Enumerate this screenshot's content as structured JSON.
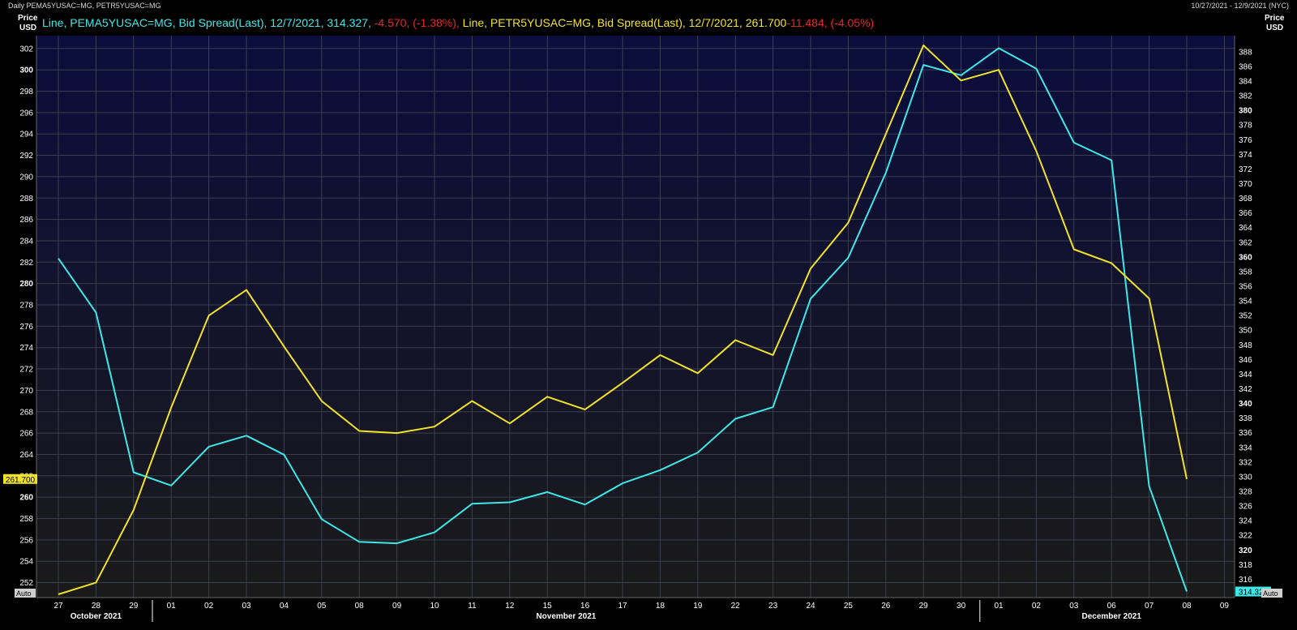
{
  "header": {
    "title": "Daily PEMA5YUSAC=MG, PETR5YUSAC=MG",
    "date_range": "10/27/2021 - 12/9/2021 (NYC)"
  },
  "axes": {
    "left_label_line1": "Price",
    "left_label_line2": "USD",
    "right_label_line1": "Price",
    "right_label_line2": "USD",
    "auto_left": "Auto",
    "auto_right": "Auto"
  },
  "legend": {
    "pema_text": "Line, PEMA5YUSAC=MG, Bid Spread(Last), 12/7/2021, 314.327, ",
    "pema_change": "-4.570, (-1.38%),",
    "petr_text": " Line, PETR5YUSAC=MG, Bid Spread(Last), 12/7/2021, 261.700",
    "petr_change": "-11.484, (-4.05%)"
  },
  "colors": {
    "pema": "#3de8e8",
    "petr": "#f2e229",
    "change_neg": "#e8262a",
    "grid": "#3a3f4e",
    "bg_top": "#0b0d3c",
    "bg_bottom": "#1a1a1a"
  },
  "chart_data": {
    "type": "line",
    "x": [
      "27",
      "28",
      "29",
      "01",
      "02",
      "03",
      "04",
      "05",
      "08",
      "09",
      "10",
      "11",
      "12",
      "15",
      "16",
      "17",
      "18",
      "19",
      "22",
      "23",
      "24",
      "25",
      "26",
      "29",
      "30",
      "01",
      "02",
      "03",
      "06",
      "07",
      "08",
      "09"
    ],
    "months": [
      {
        "label": "October 2021",
        "start_index": 0
      },
      {
        "label": "November 2021",
        "start_index": 3
      },
      {
        "label": "December 2021",
        "start_index": 25
      }
    ],
    "series": [
      {
        "name": "PEMA5YUSAC=MG",
        "axis": "right",
        "values": [
          359.8,
          352.4,
          330.6,
          328.8,
          334.1,
          335.6,
          333.0,
          324.2,
          321.1,
          320.9,
          322.4,
          326.3,
          326.5,
          327.9,
          326.2,
          329.1,
          330.9,
          333.3,
          337.9,
          339.5,
          354.3,
          359.9,
          371.5,
          386.2,
          384.8,
          388.5,
          385.7,
          375.6,
          373.2,
          328.7,
          314.327,
          null,
          null
        ]
      },
      {
        "name": "PETR5YUSAC=MG",
        "axis": "left",
        "values": [
          250.9,
          252.0,
          258.8,
          268.4,
          277.0,
          279.4,
          274.1,
          269.0,
          266.2,
          266.0,
          266.6,
          269.0,
          266.9,
          269.4,
          268.2,
          270.7,
          273.3,
          271.6,
          274.7,
          273.3,
          281.4,
          285.7,
          294.0,
          302.3,
          299.0,
          300.0,
          292.4,
          283.2,
          281.9,
          278.6,
          261.7,
          null,
          null
        ]
      }
    ],
    "left_axis": {
      "ylim": [
        250.6,
        303.2
      ],
      "ticks": [
        252,
        254,
        256,
        258,
        260,
        262,
        264,
        266,
        268,
        270,
        272,
        274,
        276,
        278,
        280,
        282,
        284,
        286,
        288,
        290,
        292,
        294,
        296,
        298,
        300,
        302
      ],
      "bold_ticks": [
        260,
        280,
        300
      ],
      "last_value_label": "261.700"
    },
    "right_axis": {
      "ylim": [
        313.5,
        390.2
      ],
      "ticks": [
        316,
        318,
        320,
        322,
        324,
        326,
        328,
        330,
        332,
        334,
        336,
        338,
        340,
        342,
        344,
        346,
        348,
        350,
        352,
        354,
        356,
        358,
        360,
        362,
        364,
        366,
        368,
        370,
        372,
        374,
        376,
        378,
        380,
        382,
        384,
        386,
        388
      ],
      "bold_ticks": [
        320,
        340,
        360,
        380
      ],
      "last_value_label": "314.327"
    },
    "grid": true
  }
}
